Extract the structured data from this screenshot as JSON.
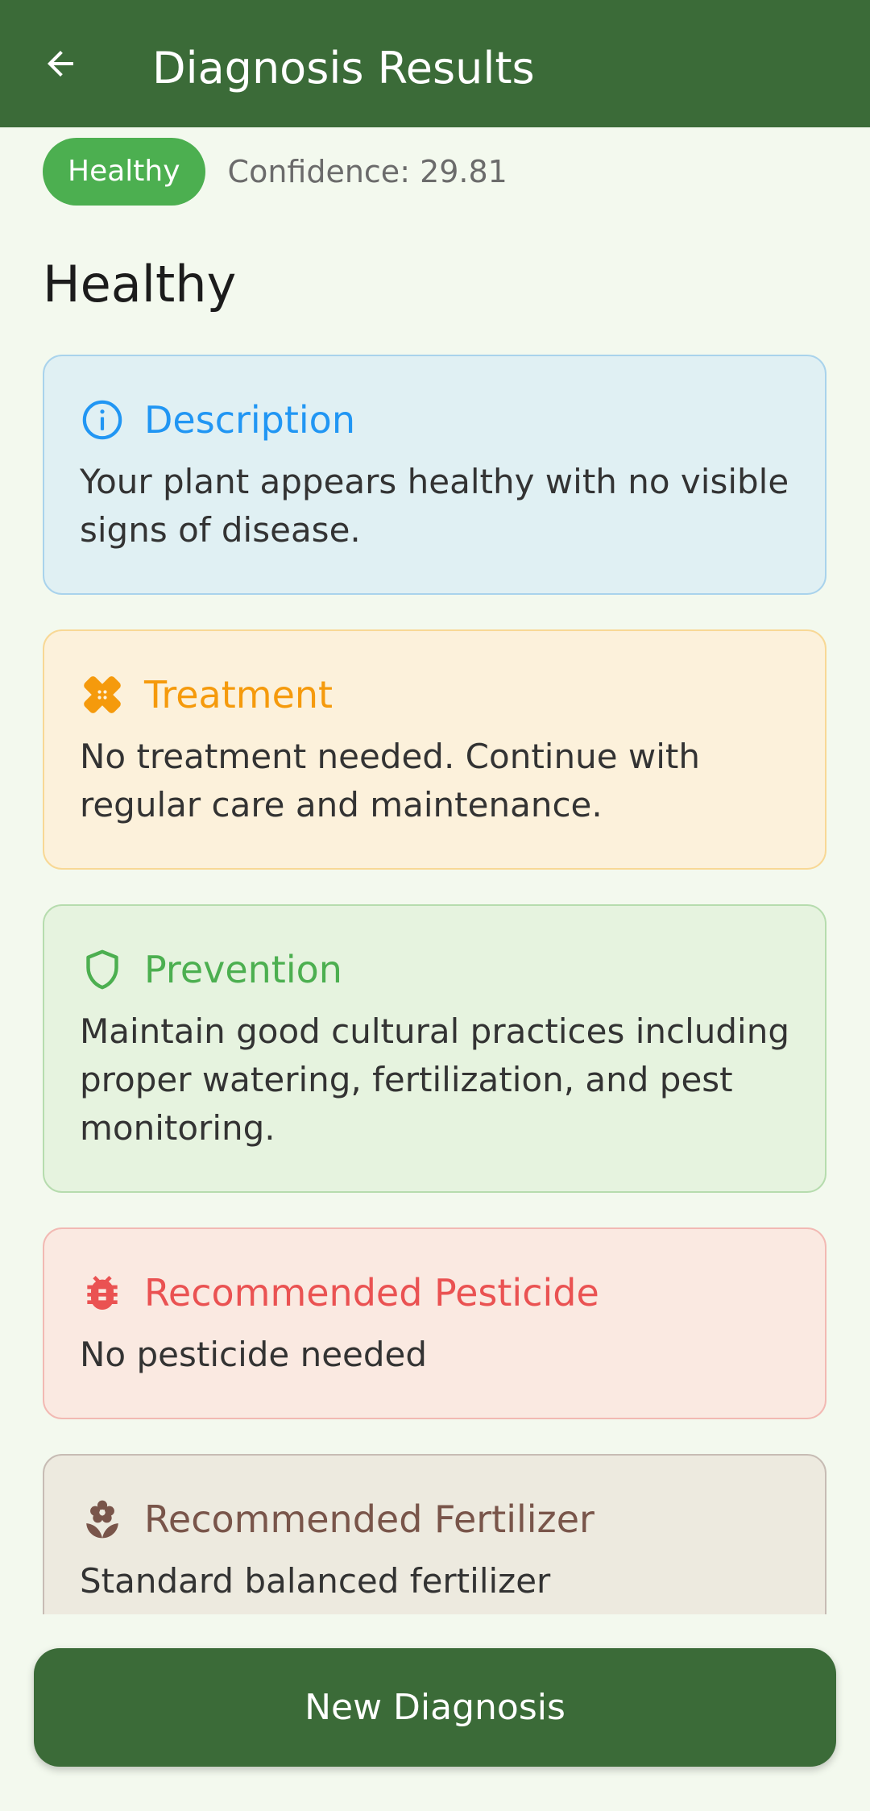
{
  "app_bar": {
    "title": "Diagnosis Results",
    "back_icon": "arrow-left-icon"
  },
  "status": {
    "badge": "Healthy",
    "confidence": "Confidence: 29.81",
    "badge_color": "#4caf50"
  },
  "diagnosis_title": "Healthy",
  "cards": {
    "description": {
      "title": "Description",
      "icon": "info-icon",
      "body": "Your plant appears healthy with no visible signs of disease.",
      "color": "#2196f3"
    },
    "treatment": {
      "title": "Treatment",
      "icon": "bandage-icon",
      "body": "No treatment needed. Continue with regular care and maintenance.",
      "color": "#f59a0c"
    },
    "prevention": {
      "title": "Prevention",
      "icon": "shield-icon",
      "body": "Maintain good cultural practices including proper watering, fertilization, and pest monitoring.",
      "color": "#4caf50"
    },
    "pesticide": {
      "title": "Recommended Pesticide",
      "icon": "bug-icon",
      "body": "No pesticide needed",
      "color": "#ea5252"
    },
    "fertilizer": {
      "title": "Recommended Fertilizer",
      "icon": "flower-icon",
      "body": "Standard balanced fertilizer",
      "color": "#79554a"
    }
  },
  "actions": {
    "new_diagnosis_label": "New Diagnosis"
  },
  "theme": {
    "primary": "#3b6b38",
    "background": "#f3f9ee"
  }
}
